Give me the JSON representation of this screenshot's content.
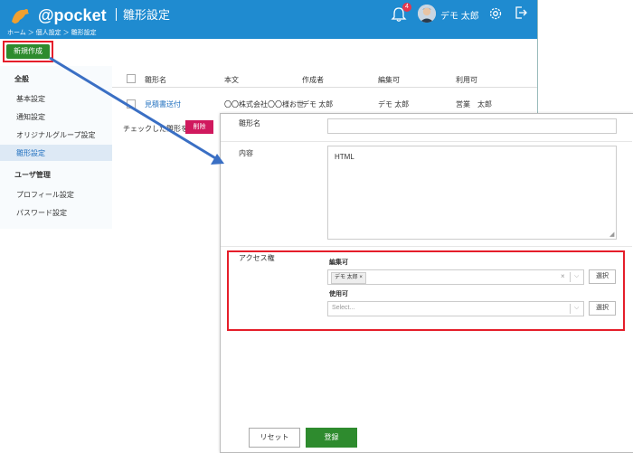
{
  "header": {
    "logo_text": "@pocket",
    "breadcrumb": "ホーム ＞ 個人設定 ＞ 雛形設定",
    "page_title": "雛形設定",
    "notification_count": "4",
    "user_name": "デモ 太郎",
    "brand_color": "#1f8bd0"
  },
  "toolbar": {
    "new_button": "新規作成"
  },
  "sidebar": {
    "group1": "全般",
    "items1": [
      "基本設定",
      "通知設定",
      "オリジナルグループ設定",
      "雛形設定"
    ],
    "group2": "ユーザ管理",
    "items2": [
      "プロフィール設定",
      "パスワード設定"
    ]
  },
  "table": {
    "columns": [
      "雛形名",
      "本文",
      "作成者",
      "編集可",
      "利用可"
    ],
    "rows": [
      {
        "name": "見積書送付",
        "body": "〇〇株式会社〇〇様お世",
        "author": "デモ 太郎",
        "editable": "デモ 太郎",
        "usable": "営業　太郎"
      }
    ],
    "delete_label": "チェックした雛形を",
    "delete_button": "削除"
  },
  "form": {
    "name_label": "雛形名",
    "name_value": "",
    "content_label": "内容",
    "content_value": "HTML",
    "access_label": "アクセス権",
    "edit_label": "編集可",
    "edit_tag": "デモ 太郎",
    "use_label": "使用可",
    "use_placeholder": "Select...",
    "choose_button": "選択",
    "reset_button": "リセット",
    "save_button": "登録"
  },
  "colors": {
    "highlight": "#e51e2a",
    "primary_green": "#2e8b2e",
    "delete_pink": "#d0195e",
    "link_blue": "#1f6fbf"
  }
}
